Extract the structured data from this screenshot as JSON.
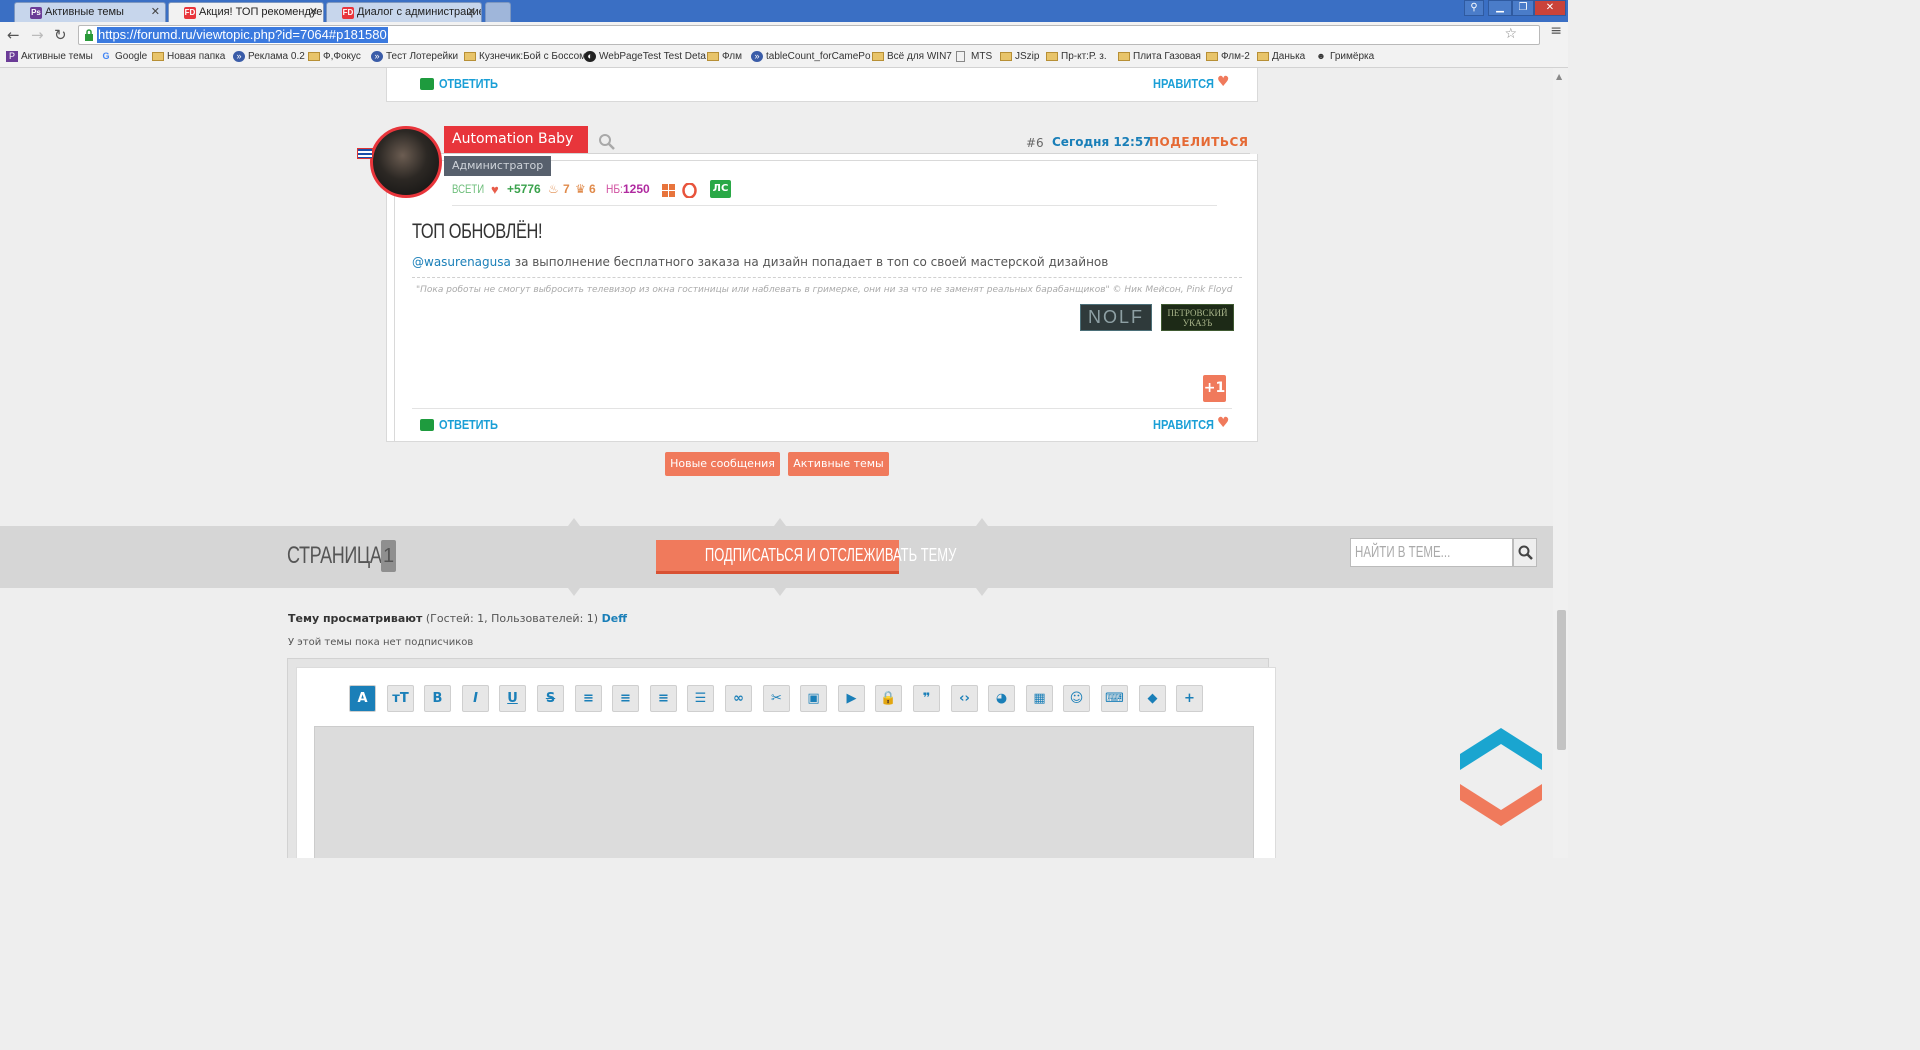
{
  "browser": {
    "tabs": [
      {
        "label": "Активные темы",
        "favicon": "ps-icon",
        "color": "#6b3c97"
      },
      {
        "label": "Акция! ТОП рекомендуемых",
        "favicon": "fd-icon",
        "color": "#e8353b"
      },
      {
        "label": "Диалог с администрацией",
        "favicon": "fd-icon",
        "color": "#e8353b"
      }
    ],
    "url": "https://forumd.ru/viewtopic.php?id=7064#p181580",
    "bookmarks": [
      {
        "label": "Активные темы",
        "icon": "ps-icon"
      },
      {
        "label": "Google",
        "icon": "google-icon"
      },
      {
        "label": "Новая папка",
        "icon": "folder-icon"
      },
      {
        "label": "Реклама 0.2",
        "icon": "fd-icon"
      },
      {
        "label": "Ф,Фокус",
        "icon": "folder-icon"
      },
      {
        "label": "Тест Лотерейки",
        "icon": "fd-icon"
      },
      {
        "label": "Кузнечик:Бой с Боссом",
        "icon": "folder-icon"
      },
      {
        "label": "WebPageTest Test Deta",
        "icon": "wpt-icon"
      },
      {
        "label": "Флм",
        "icon": "folder-icon"
      },
      {
        "label": "tableCount_forCamePo",
        "icon": "fd-icon"
      },
      {
        "label": "Всё для WIN7",
        "icon": "folder-icon"
      },
      {
        "label": "MTS",
        "icon": "page-icon"
      },
      {
        "label": "JSzip",
        "icon": "folder-icon"
      },
      {
        "label": "Пр-кт:Р. з.",
        "icon": "folder-icon"
      },
      {
        "label": "Плита Газовая",
        "icon": "folder-icon"
      },
      {
        "label": "Флм-2",
        "icon": "folder-icon"
      },
      {
        "label": "Данька",
        "icon": "folder-icon"
      },
      {
        "label": "Гримёрка",
        "icon": "theater-icon"
      }
    ]
  },
  "prev_post": {
    "reply_label": "ОТВЕТИТЬ",
    "like_label": "НРАВИТСЯ"
  },
  "post": {
    "author": "Automation Baby",
    "author_title": "Администратор",
    "number": "#6",
    "time": "Сегодня 12:57",
    "share_label": "ПОДЕЛИТЬСЯ",
    "stats": {
      "label": "ВСЕТИ",
      "likes": "+5776",
      "cake": "7",
      "trophy": "6",
      "nb_label": "НБ:",
      "nb": "1250",
      "pm_label": "ЛС"
    },
    "title": "ТОП ОБНОВЛЁН!",
    "mention": "@wasurenagusa",
    "text": " за выполнение бесплатного заказа на дизайн попадает в топ со своей мастерской дизайнов",
    "signature_quote": "\"Пока роботы не смогут выбросить телевизор из окна гостиницы или наблевать в гримерке, они ни за что не заменят реальных барабанщиков\" © Ник Мейсон, Pink Floyd",
    "banners": {
      "nolf": "NOLF",
      "petr_line1": "ПЕТРОВСКИЙ",
      "petr_line2": "УКАЗЪ"
    },
    "plus_one": "+1",
    "reply_label": "ОТВЕТИТЬ",
    "like_label": "НРАВИТСЯ"
  },
  "actions": {
    "new_messages": "Новые сообщения",
    "active_topics": "Активные темы"
  },
  "pagination": {
    "label": "СТРАНИЦА:",
    "current": "1",
    "subscribe": "ПОДПИСАТЬСЯ И ОТСЛЕЖИВАТЬ ТЕМУ",
    "search_placeholder": "НАЙТИ В ТЕМЕ..."
  },
  "viewers": {
    "label": "Тему просматривают",
    "counts": " (Гостей: 1, Пользователей: 1) ",
    "user": "Deff",
    "subscribers": "У этой темы пока нет подписчиков"
  },
  "editor": {
    "buttons": [
      {
        "name": "font-icon",
        "glyph": "A"
      },
      {
        "name": "font-size-icon",
        "glyph": "тT"
      },
      {
        "name": "bold-icon",
        "glyph": "B"
      },
      {
        "name": "italic-icon",
        "glyph": "I"
      },
      {
        "name": "underline-icon",
        "glyph": "U"
      },
      {
        "name": "strikethrough-icon",
        "glyph": "S"
      },
      {
        "name": "align-left-icon",
        "glyph": "≡"
      },
      {
        "name": "align-center-icon",
        "glyph": "≡"
      },
      {
        "name": "align-right-icon",
        "glyph": "≡"
      },
      {
        "name": "list-icon",
        "glyph": "☰"
      },
      {
        "name": "link-icon",
        "glyph": "∞"
      },
      {
        "name": "cut-icon",
        "glyph": "✂"
      },
      {
        "name": "image-icon",
        "glyph": "▣"
      },
      {
        "name": "video-icon",
        "glyph": "▶"
      },
      {
        "name": "lock-icon",
        "glyph": "🔒"
      },
      {
        "name": "quote-icon",
        "glyph": "❞"
      },
      {
        "name": "code-icon",
        "glyph": "‹›"
      },
      {
        "name": "palette-icon",
        "glyph": "◕"
      },
      {
        "name": "table-icon",
        "glyph": "▦"
      },
      {
        "name": "smile-icon",
        "glyph": "☺"
      },
      {
        "name": "keyboard-icon",
        "glyph": "⌨"
      },
      {
        "name": "eraser-icon",
        "glyph": "◆"
      },
      {
        "name": "more-icon",
        "glyph": "+"
      }
    ]
  },
  "colors": {
    "accent": "#f07a5c",
    "brand_red": "#e8353b",
    "link_blue": "#1a9fd6",
    "reply_green": "#1e9b3e",
    "scroll_up": "#1aa5d0",
    "scroll_down": "#f07a5c"
  }
}
